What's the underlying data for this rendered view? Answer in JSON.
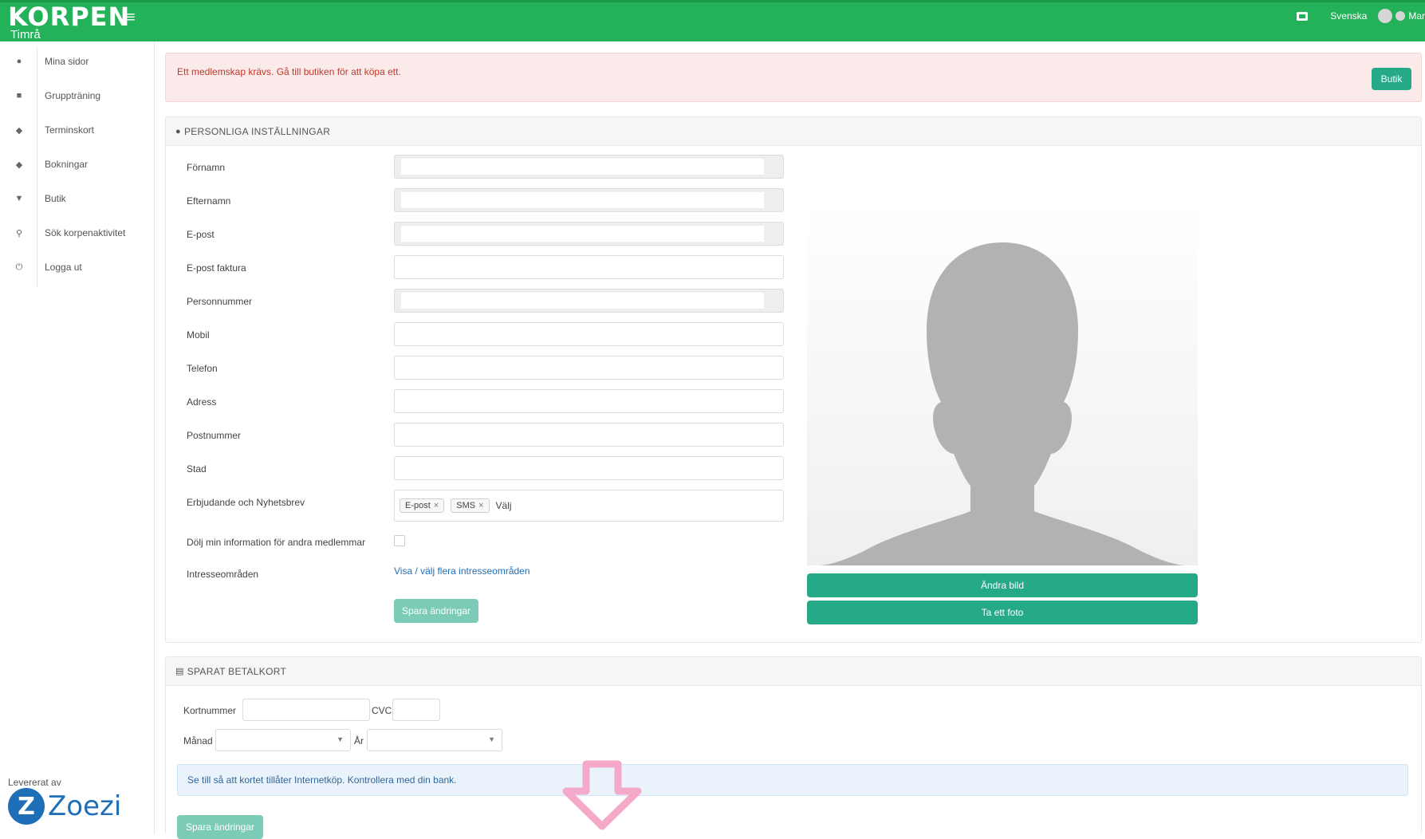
{
  "header": {
    "brand": "KORPEN",
    "place": "Timrå",
    "language": "Svenska",
    "user": "Mar"
  },
  "sidebar": {
    "items": [
      {
        "label": "Mina sidor",
        "icon": "user-icon"
      },
      {
        "label": "Gruppträning",
        "icon": "calendar-icon"
      },
      {
        "label": "Terminskort",
        "icon": "tag-icon"
      },
      {
        "label": "Bokningar",
        "icon": "tag-icon"
      },
      {
        "label": "Butik",
        "icon": "cart-icon"
      },
      {
        "label": "Sök korpenaktivitet",
        "icon": "search-icon"
      },
      {
        "label": "Logga ut",
        "icon": "power-icon"
      }
    ],
    "powered_by": "Levererat av",
    "powered_brand": "Zoezi",
    "powered_mark": "Z"
  },
  "alert": {
    "message": "Ett medlemskap krävs. Gå till butiken för att köpa ett.",
    "button": "Butik"
  },
  "personal": {
    "title": "PERSONLIGA INSTÄLLNINGAR",
    "fields": {
      "firstname": "Förnamn",
      "lastname": "Efternamn",
      "email": "E-post",
      "email_invoice": "E-post faktura",
      "personal_number": "Personnummer",
      "mobile": "Mobil",
      "phone": "Telefon",
      "address": "Adress",
      "postal_code": "Postnummer",
      "city": "Stad",
      "offers": "Erbjudande och Nyhetsbrev",
      "hide_info": "Dölj min information för andra medlemmar",
      "interests": "Intresseområden"
    },
    "offer_tags": [
      "E-post",
      "SMS"
    ],
    "offer_more": "Välj",
    "interests_link": "Visa / välj flera intresseområden",
    "save_button": "Spara ändringar",
    "photo": {
      "change_button": "Ändra bild",
      "remove_button": "Ta ett foto"
    }
  },
  "cards": {
    "title": "SPARAT BETALKORT",
    "card_number_label": "Kortnummer",
    "cvc_label": "CVC",
    "month_label": "Månad",
    "year_label": "År",
    "info": "Se till så att kortet tillåter Internetköp. Kontrollera med din bank.",
    "save_button": "Spara ändringar"
  },
  "colors": {
    "header": "#23b159",
    "button": "#26a986",
    "alert_bg": "#fbeaea",
    "alert_text": "#c0392b",
    "link": "#1f6fb8",
    "arrow": "#f5a9c8"
  }
}
